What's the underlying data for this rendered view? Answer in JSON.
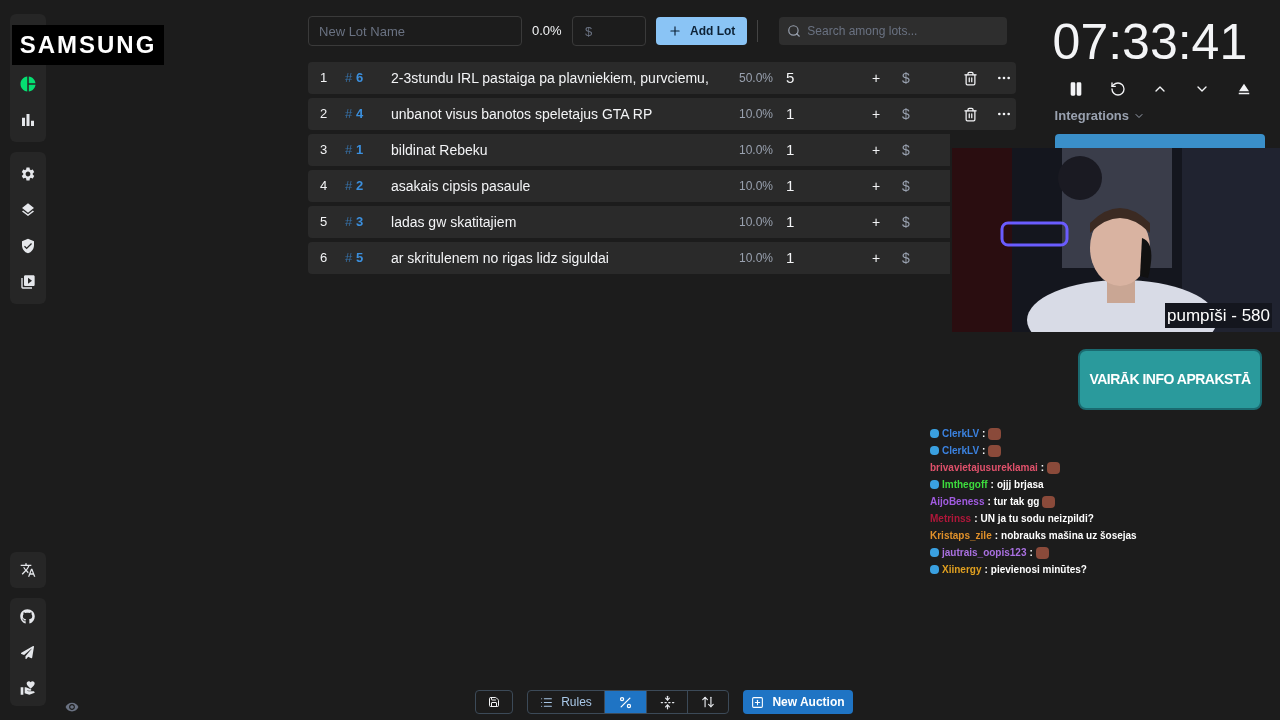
{
  "overlay_logo": "SAMSUNG",
  "new_lot": {
    "name_placeholder": "New Lot Name",
    "percent": "0.0%",
    "amount_placeholder": "$",
    "add_button": "Add Lot"
  },
  "search": {
    "placeholder": "Search among lots..."
  },
  "lots": [
    {
      "index": "1",
      "hash": "#",
      "id": "6",
      "name": "2-3stundu IRL pastaiga pa plavniekiem, purvciemu,",
      "percent": "50.0%",
      "amount": "5",
      "plus": "+",
      "dollar": "$",
      "actions_visible": true
    },
    {
      "index": "2",
      "hash": "#",
      "id": "4",
      "name": "unbanot visus banotos speletajus GTA RP",
      "percent": "10.0%",
      "amount": "1",
      "plus": "+",
      "dollar": "$",
      "actions_visible": true
    },
    {
      "index": "3",
      "hash": "#",
      "id": "1",
      "name": "bildinat Rebeku",
      "percent": "10.0%",
      "amount": "1",
      "plus": "+",
      "dollar": "$",
      "actions_visible": false
    },
    {
      "index": "4",
      "hash": "#",
      "id": "2",
      "name": "asakais cipsis pasaule",
      "percent": "10.0%",
      "amount": "1",
      "plus": "+",
      "dollar": "$",
      "actions_visible": false
    },
    {
      "index": "5",
      "hash": "#",
      "id": "3",
      "name": "ladas gw skatitajiem",
      "percent": "10.0%",
      "amount": "1",
      "plus": "+",
      "dollar": "$",
      "actions_visible": false
    },
    {
      "index": "6",
      "hash": "#",
      "id": "5",
      "name": "ar skritulenem no rigas lidz siguldai",
      "percent": "10.0%",
      "amount": "1",
      "plus": "+",
      "dollar": "$",
      "actions_visible": false
    }
  ],
  "timer": {
    "time": "07:33:41"
  },
  "integrations": "Integrations",
  "webcam": {
    "kind": "picture",
    "caption": "pumpīši - 580"
  },
  "banner": "VAIRĀK INFO APRAKSTĀ",
  "chat": [
    {
      "user": "ClerkLV",
      "color": "#3b82e0",
      "separator": ":",
      "emote": true,
      "badge": true
    },
    {
      "user": "ClerkLV",
      "color": "#3b82e0",
      "separator": ":",
      "emote": true,
      "badge": true
    },
    {
      "user": "brivavietajusureklamai",
      "color": "#e0516b",
      "separator": ":",
      "emote": true,
      "badge": false
    },
    {
      "user": "Imthegoff",
      "color": "#3ddc3d",
      "separator": ":",
      "text": "ojjj brjasa",
      "emote": false,
      "badge": true
    },
    {
      "user": "AijoBeness",
      "color": "#a15be0",
      "separator": ":",
      "text": "tur tak gg",
      "emote": true,
      "badge": false
    },
    {
      "user": "Metrinss",
      "color": "#b0173a",
      "separator": ":",
      "text": "UN ja tu sodu neizpildi?",
      "emote": false,
      "badge": false
    },
    {
      "user": "Kristaps_zile",
      "color": "#e0902a",
      "separator": ":",
      "text": "nobrauks mašina uz šosejas",
      "emote": false,
      "badge": false
    },
    {
      "user": "jautrais_oopis123",
      "color": "#a970e0",
      "separator": ":",
      "emote": true,
      "badge": true
    },
    {
      "user": "Xiinergy",
      "color": "#e0a020",
      "separator": ":",
      "text": "pievienosi minūtes?",
      "emote": false,
      "badge": true
    }
  ],
  "toolbar": {
    "rules": "Rules",
    "new_auction": "New Auction",
    "modes": [
      {
        "kind": "percent",
        "selected": true
      },
      {
        "kind": "fold",
        "selected": false
      },
      {
        "kind": "sort",
        "selected": false
      }
    ]
  }
}
